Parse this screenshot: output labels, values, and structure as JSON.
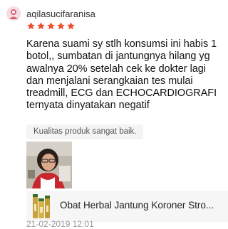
{
  "review": {
    "username": "aqilasucifaranisa",
    "rating": 5,
    "comment": "Karena suami sy stlh konsumsi ini habis 1 botol,, sumbatan di jantungnya hilang yg awalnya 20% setelah cek ke dokter lagi dan menjalani serangkaian tes mulai treadmill, ECG dan ECHOCARDIOGRAFI ternyata dinyatakan negatif",
    "tag": "Kualitas produk sangat baik.",
    "product_name": "Obat Herbal Jantung Koroner Stro...",
    "timestamp": "21-02-2019 12:01"
  },
  "colors": {
    "star": "#ee4d2d",
    "chip_background": "#f4f4f4",
    "card_background": "#f6f6f6",
    "timestamp": "#9a9a9a"
  },
  "icons": {
    "star": "star-icon",
    "avatar": "avatar"
  }
}
